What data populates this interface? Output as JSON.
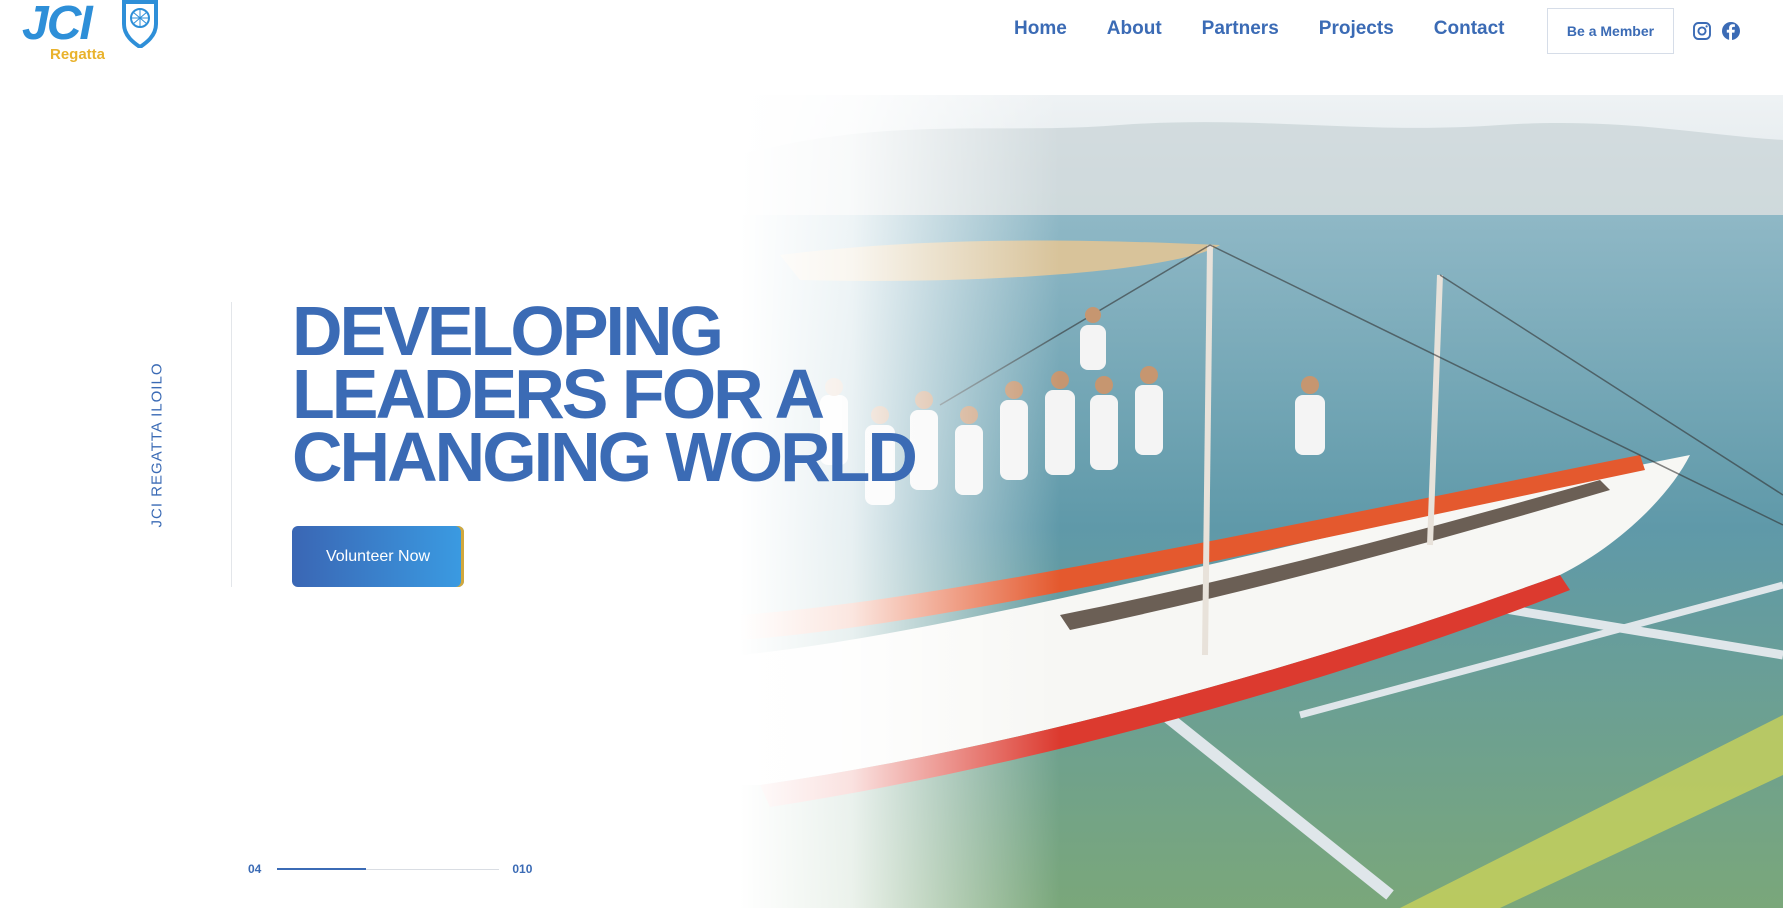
{
  "brand": {
    "logo_text": "JCI",
    "logo_subtext": "Regatta",
    "primary_color": "#3b6bb5",
    "accent_color": "#e9b22c"
  },
  "nav": {
    "items": [
      {
        "label": "Home"
      },
      {
        "label": "About"
      },
      {
        "label": "Partners"
      },
      {
        "label": "Projects"
      },
      {
        "label": "Contact"
      }
    ],
    "cta_label": "Be a Member",
    "social": [
      "instagram-icon",
      "facebook-icon"
    ]
  },
  "hero": {
    "side_label": "JCI REGATTA ILOILO",
    "headline": [
      "DEVELOPING",
      "LEADERS FOR A",
      "CHANGING WORLD"
    ],
    "button_label": "Volunteer Now",
    "button_gradient": [
      "#3a66b4",
      "#3a9be2"
    ]
  },
  "slider": {
    "current": "04",
    "total": "010",
    "progress": 0.4
  }
}
